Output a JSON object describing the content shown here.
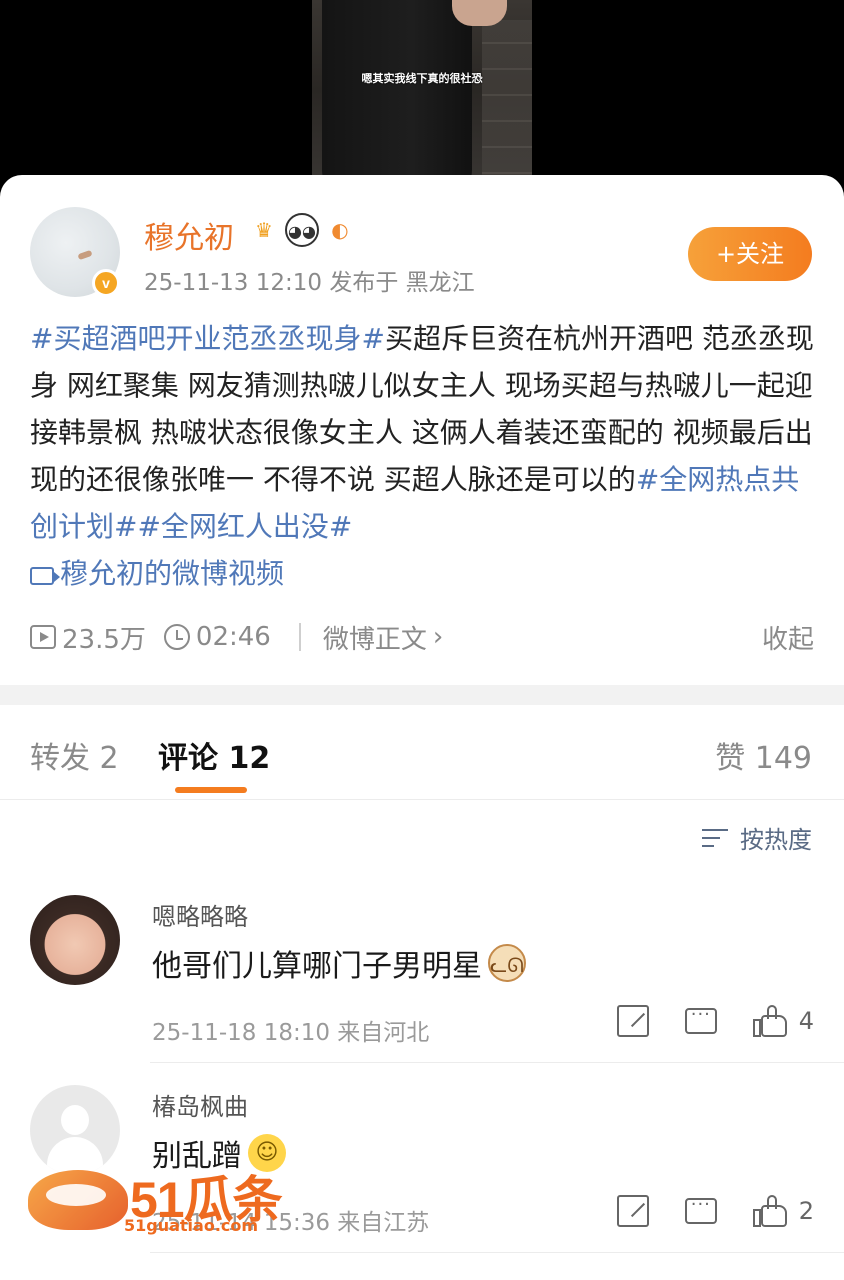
{
  "video": {
    "subtitle": "嗯其实我线下真的很社恐"
  },
  "post": {
    "author": "穆允初",
    "badges": [
      "crown-badge",
      "panda-badge",
      "fish-badge"
    ],
    "verified_mark": "v",
    "timestamp": "25-11-13 12:10",
    "location": "发布于 黑龙江",
    "follow_label": "+关注",
    "text_parts": [
      {
        "type": "tag",
        "text": "#买超酒吧开业范丞丞现身#"
      },
      {
        "type": "text",
        "text": "买超斥巨资在杭州开酒吧 范丞丞现身 网红聚集 网友猜测热啵儿似女主人  现场买超与热啵儿一起迎接韩景枫 热啵状态很像女主人 这俩人着装还蛮配的 视频最后出现的还很像张唯一 不得不说 买超人脉还是可以的"
      },
      {
        "type": "tag",
        "text": "#全网热点共创计划#"
      },
      {
        "type": "tag",
        "text": "#全网红人出没#"
      }
    ],
    "video_link": "穆允初的微博视频",
    "views": "23.5万",
    "duration": "02:46",
    "weibo_text_link": "微博正文",
    "collapse_label": "收起"
  },
  "tabs": {
    "repost": "转发 2",
    "comment": "评论 12",
    "like": "赞 149"
  },
  "sort_label": "按热度",
  "comments": [
    {
      "name": "嗯略略略",
      "text": "他哥们儿算哪门子男明星",
      "emoji": "cat-emoji",
      "time_location": "25-11-18 18:10  来自河北",
      "likes": "4"
    },
    {
      "name": "椿岛枫曲",
      "text": "别乱蹭",
      "emoji": "laugh-cry-emoji",
      "time_location": "25-11-14 15:36  来自江苏",
      "likes": "2"
    }
  ],
  "watermark": {
    "brand": "51瓜条",
    "url": "51guatiao.com"
  },
  "colors": {
    "accent": "#f47c1f",
    "author": "#e8742a",
    "link": "#5078b8",
    "sort": "#5a6b85"
  }
}
